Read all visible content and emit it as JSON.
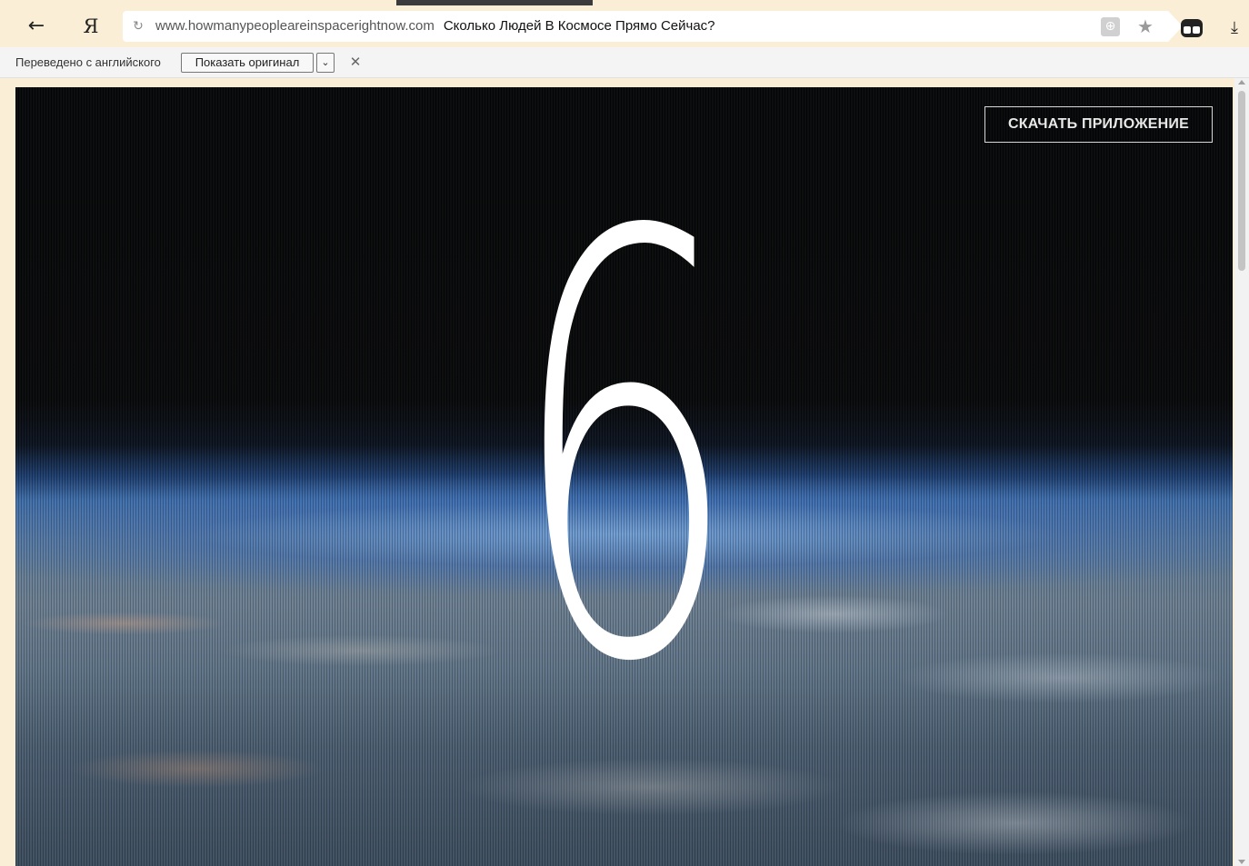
{
  "browser": {
    "back_icon": "←",
    "logo": "Я",
    "reload_icon": "↻",
    "url_domain": "www.howmanypeopleareinspacerightnow.com",
    "page_title": "Сколько Людей В Космосе Прямо Сейчас?",
    "translate_icon": "⊕",
    "bookmark_icon": "★",
    "download_icon": "⤓"
  },
  "translate_bar": {
    "label": "Переведено с английского",
    "show_original": "Показать оригинал",
    "dropdown_icon": "⌄",
    "close_icon": "✕"
  },
  "page": {
    "download_app": "СКАЧАТЬ ПРИЛОЖЕНИЕ",
    "people_count": "6"
  }
}
